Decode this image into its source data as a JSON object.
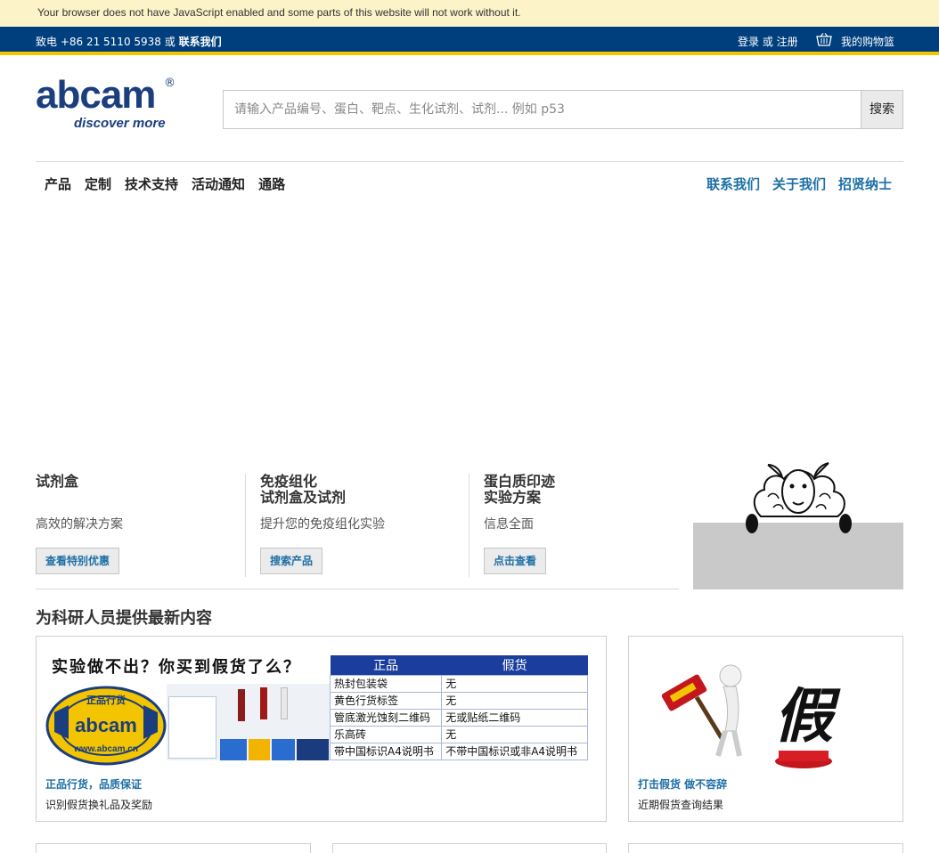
{
  "noscript": "Your browser does not have JavaScript enabled and some parts of this website will not work without it.",
  "topbar": {
    "phone_prefix": "致电 +86 21 5110 5938 或",
    "contact": "联系我们",
    "login": "登录 或 注册",
    "cart": "我的购物篮"
  },
  "logo": {
    "word": "abcam",
    "reg": "®",
    "tagline": "discover more"
  },
  "search": {
    "placeholder": "请输入产品编号、蛋白、靶点、生化试剂、试剂... 例如 p53",
    "button": "搜索"
  },
  "nav": {
    "main": [
      "产品",
      "定制",
      "技术支持",
      "活动通知",
      "通路"
    ],
    "right": [
      "联系我们",
      "关于我们",
      "招贤纳士"
    ]
  },
  "promos": [
    {
      "title": "试剂盒",
      "desc": "高效的解决方案",
      "button": "查看特别优惠"
    },
    {
      "title_line1": "免疫组化",
      "title_line2": "试剂盒及试剂",
      "desc": "提升您的免疫组化实验",
      "button": "搜索产品"
    },
    {
      "title_line1": "蛋白质印迹",
      "title_line2": "实验方案",
      "desc": "信息全面",
      "button": "点击查看"
    }
  ],
  "section_title": "为科研人员提供最新内容",
  "cards": [
    {
      "headline": "实验做不出？你买到假货了么？",
      "seal_top": "正品行货",
      "seal_brand": "abcam",
      "seal_bottom": "www.abcam.cn",
      "table_headers": [
        "正品",
        "假货"
      ],
      "table_rows": [
        [
          "热封包装袋",
          "无"
        ],
        [
          "黄色行货标签",
          "无"
        ],
        [
          "管底激光蚀刻二维码",
          "无或贴纸二维码"
        ],
        [
          "乐高砖",
          "无"
        ],
        [
          "带中国标识A4说明书",
          "不带中国标识或非A4说明书"
        ]
      ],
      "title": "正品行货，品质保证",
      "subtitle": "识别假货换礼品及奖励"
    },
    {
      "fake_char": "假",
      "title": "打击假货 做不容辞",
      "subtitle": "近期假货查询结果"
    }
  ],
  "colors": {
    "topbar": "#003f7d",
    "topbar_accent": "#f2c700",
    "link": "#1d6fa5",
    "brand": "#1b3e7e",
    "table_header": "#1b3e9e"
  }
}
